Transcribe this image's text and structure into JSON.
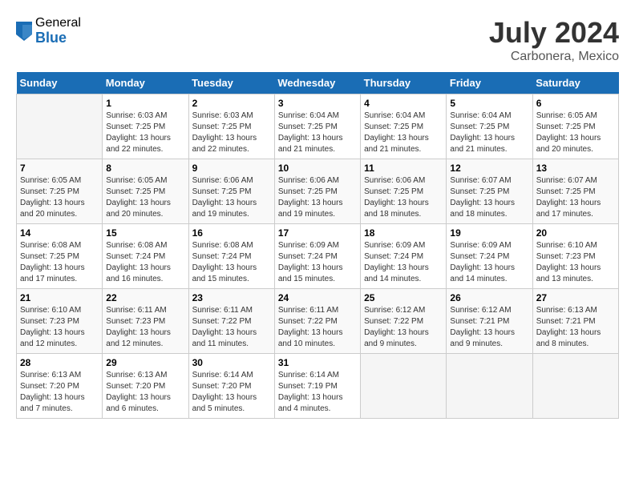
{
  "logo": {
    "general": "General",
    "blue": "Blue"
  },
  "title": {
    "month": "July 2024",
    "location": "Carbonera, Mexico"
  },
  "headers": [
    "Sunday",
    "Monday",
    "Tuesday",
    "Wednesday",
    "Thursday",
    "Friday",
    "Saturday"
  ],
  "weeks": [
    [
      {
        "day": "",
        "sunrise": "",
        "sunset": "",
        "daylight": ""
      },
      {
        "day": "1",
        "sunrise": "Sunrise: 6:03 AM",
        "sunset": "Sunset: 7:25 PM",
        "daylight": "Daylight: 13 hours and 22 minutes."
      },
      {
        "day": "2",
        "sunrise": "Sunrise: 6:03 AM",
        "sunset": "Sunset: 7:25 PM",
        "daylight": "Daylight: 13 hours and 22 minutes."
      },
      {
        "day": "3",
        "sunrise": "Sunrise: 6:04 AM",
        "sunset": "Sunset: 7:25 PM",
        "daylight": "Daylight: 13 hours and 21 minutes."
      },
      {
        "day": "4",
        "sunrise": "Sunrise: 6:04 AM",
        "sunset": "Sunset: 7:25 PM",
        "daylight": "Daylight: 13 hours and 21 minutes."
      },
      {
        "day": "5",
        "sunrise": "Sunrise: 6:04 AM",
        "sunset": "Sunset: 7:25 PM",
        "daylight": "Daylight: 13 hours and 21 minutes."
      },
      {
        "day": "6",
        "sunrise": "Sunrise: 6:05 AM",
        "sunset": "Sunset: 7:25 PM",
        "daylight": "Daylight: 13 hours and 20 minutes."
      }
    ],
    [
      {
        "day": "7",
        "sunrise": "Sunrise: 6:05 AM",
        "sunset": "Sunset: 7:25 PM",
        "daylight": "Daylight: 13 hours and 20 minutes."
      },
      {
        "day": "8",
        "sunrise": "Sunrise: 6:05 AM",
        "sunset": "Sunset: 7:25 PM",
        "daylight": "Daylight: 13 hours and 20 minutes."
      },
      {
        "day": "9",
        "sunrise": "Sunrise: 6:06 AM",
        "sunset": "Sunset: 7:25 PM",
        "daylight": "Daylight: 13 hours and 19 minutes."
      },
      {
        "day": "10",
        "sunrise": "Sunrise: 6:06 AM",
        "sunset": "Sunset: 7:25 PM",
        "daylight": "Daylight: 13 hours and 19 minutes."
      },
      {
        "day": "11",
        "sunrise": "Sunrise: 6:06 AM",
        "sunset": "Sunset: 7:25 PM",
        "daylight": "Daylight: 13 hours and 18 minutes."
      },
      {
        "day": "12",
        "sunrise": "Sunrise: 6:07 AM",
        "sunset": "Sunset: 7:25 PM",
        "daylight": "Daylight: 13 hours and 18 minutes."
      },
      {
        "day": "13",
        "sunrise": "Sunrise: 6:07 AM",
        "sunset": "Sunset: 7:25 PM",
        "daylight": "Daylight: 13 hours and 17 minutes."
      }
    ],
    [
      {
        "day": "14",
        "sunrise": "Sunrise: 6:08 AM",
        "sunset": "Sunset: 7:25 PM",
        "daylight": "Daylight: 13 hours and 17 minutes."
      },
      {
        "day": "15",
        "sunrise": "Sunrise: 6:08 AM",
        "sunset": "Sunset: 7:24 PM",
        "daylight": "Daylight: 13 hours and 16 minutes."
      },
      {
        "day": "16",
        "sunrise": "Sunrise: 6:08 AM",
        "sunset": "Sunset: 7:24 PM",
        "daylight": "Daylight: 13 hours and 15 minutes."
      },
      {
        "day": "17",
        "sunrise": "Sunrise: 6:09 AM",
        "sunset": "Sunset: 7:24 PM",
        "daylight": "Daylight: 13 hours and 15 minutes."
      },
      {
        "day": "18",
        "sunrise": "Sunrise: 6:09 AM",
        "sunset": "Sunset: 7:24 PM",
        "daylight": "Daylight: 13 hours and 14 minutes."
      },
      {
        "day": "19",
        "sunrise": "Sunrise: 6:09 AM",
        "sunset": "Sunset: 7:24 PM",
        "daylight": "Daylight: 13 hours and 14 minutes."
      },
      {
        "day": "20",
        "sunrise": "Sunrise: 6:10 AM",
        "sunset": "Sunset: 7:23 PM",
        "daylight": "Daylight: 13 hours and 13 minutes."
      }
    ],
    [
      {
        "day": "21",
        "sunrise": "Sunrise: 6:10 AM",
        "sunset": "Sunset: 7:23 PM",
        "daylight": "Daylight: 13 hours and 12 minutes."
      },
      {
        "day": "22",
        "sunrise": "Sunrise: 6:11 AM",
        "sunset": "Sunset: 7:23 PM",
        "daylight": "Daylight: 13 hours and 12 minutes."
      },
      {
        "day": "23",
        "sunrise": "Sunrise: 6:11 AM",
        "sunset": "Sunset: 7:22 PM",
        "daylight": "Daylight: 13 hours and 11 minutes."
      },
      {
        "day": "24",
        "sunrise": "Sunrise: 6:11 AM",
        "sunset": "Sunset: 7:22 PM",
        "daylight": "Daylight: 13 hours and 10 minutes."
      },
      {
        "day": "25",
        "sunrise": "Sunrise: 6:12 AM",
        "sunset": "Sunset: 7:22 PM",
        "daylight": "Daylight: 13 hours and 9 minutes."
      },
      {
        "day": "26",
        "sunrise": "Sunrise: 6:12 AM",
        "sunset": "Sunset: 7:21 PM",
        "daylight": "Daylight: 13 hours and 9 minutes."
      },
      {
        "day": "27",
        "sunrise": "Sunrise: 6:13 AM",
        "sunset": "Sunset: 7:21 PM",
        "daylight": "Daylight: 13 hours and 8 minutes."
      }
    ],
    [
      {
        "day": "28",
        "sunrise": "Sunrise: 6:13 AM",
        "sunset": "Sunset: 7:20 PM",
        "daylight": "Daylight: 13 hours and 7 minutes."
      },
      {
        "day": "29",
        "sunrise": "Sunrise: 6:13 AM",
        "sunset": "Sunset: 7:20 PM",
        "daylight": "Daylight: 13 hours and 6 minutes."
      },
      {
        "day": "30",
        "sunrise": "Sunrise: 6:14 AM",
        "sunset": "Sunset: 7:20 PM",
        "daylight": "Daylight: 13 hours and 5 minutes."
      },
      {
        "day": "31",
        "sunrise": "Sunrise: 6:14 AM",
        "sunset": "Sunset: 7:19 PM",
        "daylight": "Daylight: 13 hours and 4 minutes."
      },
      {
        "day": "",
        "sunrise": "",
        "sunset": "",
        "daylight": ""
      },
      {
        "day": "",
        "sunrise": "",
        "sunset": "",
        "daylight": ""
      },
      {
        "day": "",
        "sunrise": "",
        "sunset": "",
        "daylight": ""
      }
    ]
  ]
}
